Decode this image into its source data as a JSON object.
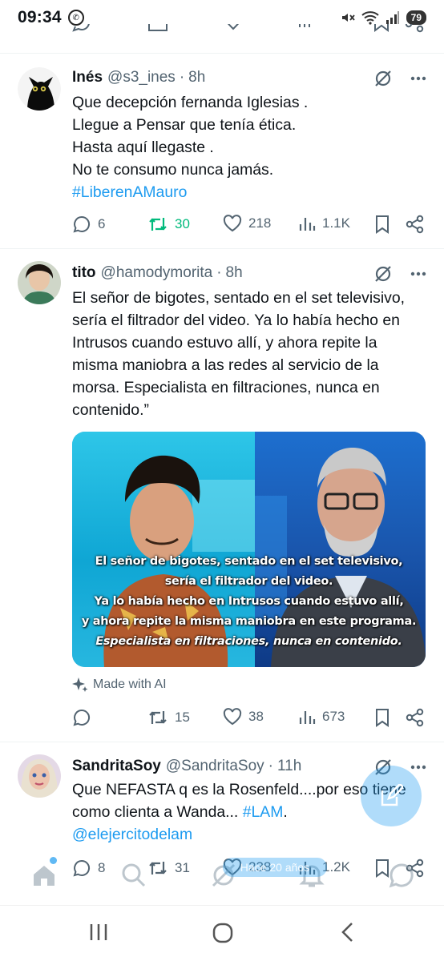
{
  "status": {
    "time": "09:34",
    "battery": "79"
  },
  "tweets": [
    {
      "name": "Inés",
      "handle": "@s3_ines",
      "time": "8h",
      "lines": [
        {
          "text": "Que decepción fernanda Iglesias ."
        },
        {
          "text": "Llegue a Pensar que tenía ética."
        },
        {
          "text": "Hasta aquí llegaste ."
        },
        {
          "text": "No te consumo nunca jamás."
        },
        {
          "text": "#LiberenAMauro"
        }
      ],
      "stats": {
        "replies": "6",
        "retweets": "30",
        "likes": "218",
        "views": "1.1K"
      }
    },
    {
      "name": "tito",
      "handle": "@hamodymorita",
      "time": "8h",
      "lines": [
        {
          "text": "El señor de bigotes, sentado en el set televisivo,"
        },
        {
          "text": "sería el filtrador del video. Ya lo había hecho en"
        },
        {
          "text": "Intrusos cuando estuvo allí, y ahora repite la"
        },
        {
          "text": "misma maniobra a las redes al servicio de la"
        },
        {
          "text": "morsa. Especialista en filtraciones, nunca en"
        },
        {
          "text": "contenido.”"
        }
      ],
      "media_caption": [
        "El señor de bigotes, sentado en el set televisivo,",
        "sería el filtrador del video.",
        "Ya lo había hecho en Intrusos cuando estuvo allí,",
        "y ahora repite la misma maniobra en este programa.",
        "Especialista en filtraciones, nunca en contenido."
      ],
      "made_with_ai": "Made with AI",
      "stats": {
        "replies": "",
        "retweets": "15",
        "likes": "38",
        "views": "673"
      }
    },
    {
      "name": "SandritaSoy",
      "handle": "@SandritaSoy",
      "time": "11h",
      "line1": "Que NEFASTA q es la Rosenfeld....por eso tiene",
      "line2a": "como clienta a Wanda... ",
      "line2b": "#LAM",
      "line2c": ".",
      "line3": "@elejercitodelam",
      "stats": {
        "replies": "8",
        "retweets": "31",
        "likes": "238",
        "views": "1.2K"
      }
    }
  ],
  "overlay_pill": "Hace 20 años",
  "colors": {
    "accent": "#1d9bf0",
    "retweet_active": "#00ba7c",
    "muted": "#536471"
  }
}
